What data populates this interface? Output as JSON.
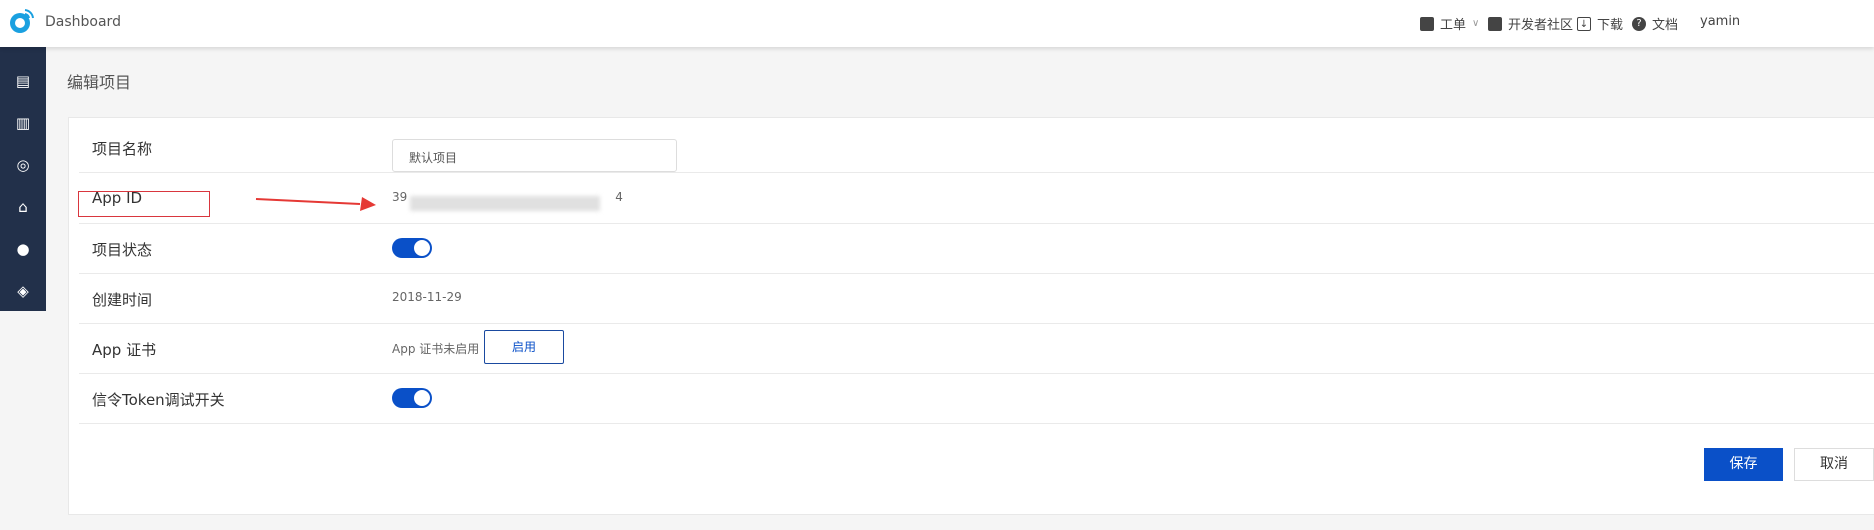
{
  "header": {
    "brand": "Dashboard",
    "nav": [
      {
        "label": "工单",
        "icon": "ticket-icon"
      },
      {
        "label": "开发者社区",
        "icon": "community-icon"
      },
      {
        "label": "下载",
        "icon": "download-icon"
      },
      {
        "label": "文档",
        "icon": "help-icon"
      }
    ],
    "user": "yamin"
  },
  "sidebar": {
    "icons": [
      "project-list-icon",
      "analytics-icon",
      "dashboard-gauge-icon",
      "billing-icon",
      "user-icon",
      "layers-icon"
    ]
  },
  "page": {
    "title": "编辑项目"
  },
  "form": {
    "name_label": "项目名称",
    "name_value": "默认项目",
    "appid_label": "App ID",
    "appid_prefix": "39",
    "appid_suffix": "4",
    "status_label": "项目状态",
    "status_on": true,
    "created_label": "创建时间",
    "created_value": "2018-11-29",
    "cert_label": "App 证书",
    "cert_status": "App 证书未启用",
    "cert_enable": "启用",
    "token_label": "信令Token调试开关",
    "token_on": true,
    "save": "保存",
    "cancel": "取消"
  },
  "colors": {
    "accent": "#0a50c8",
    "sidebar": "#22304a",
    "annotation": "#e53935"
  }
}
